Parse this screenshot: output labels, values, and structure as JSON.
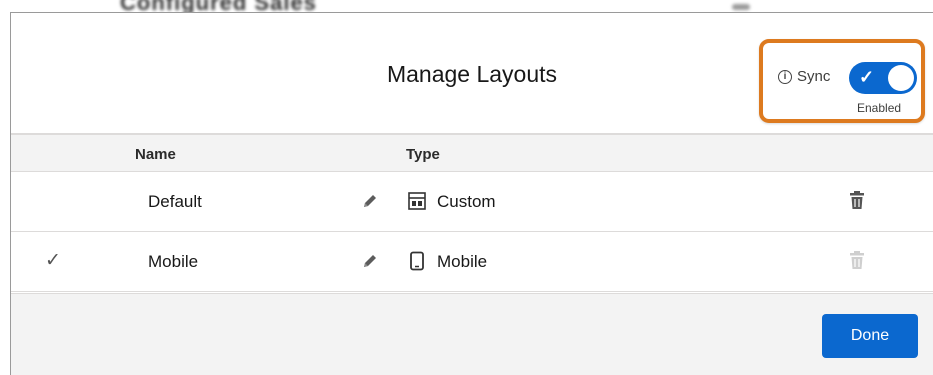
{
  "background": {
    "page_title": "Configured Sales"
  },
  "modal": {
    "title": "Manage Layouts",
    "sync": {
      "label": "Sync",
      "state": "Enabled",
      "enabled": true,
      "info_icon": "info-icon",
      "highlight_color": "#dd7a1f"
    },
    "table": {
      "columns": [
        "Name",
        "Type"
      ],
      "rows": [
        {
          "selected": false,
          "name": "Default",
          "type": "Custom",
          "type_icon": "layout-icon",
          "delete_enabled": true
        },
        {
          "selected": true,
          "name": "Mobile",
          "type": "Mobile",
          "type_icon": "phone-icon",
          "delete_enabled": false
        }
      ]
    },
    "footer": {
      "done_label": "Done"
    }
  },
  "colors": {
    "brand": "#0b68cf",
    "highlight": "#dd7a1f",
    "header_bg": "#f3f3f3",
    "border": "#dddbda"
  }
}
